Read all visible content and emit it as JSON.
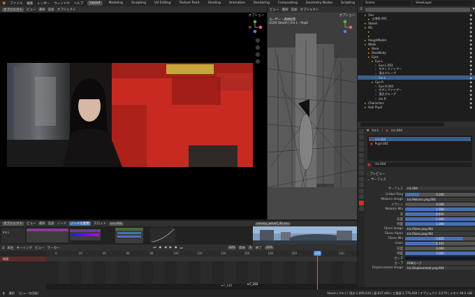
{
  "topbar": {
    "menus": [
      "ファイル",
      "編集",
      "レンダー",
      "ウィンドウ",
      "ヘルプ"
    ],
    "workspaces": [
      "Layout",
      "Modeling",
      "Sculpting",
      "UV Editing",
      "Texture Paint",
      "Shading",
      "Animation",
      "Rendering",
      "Compositing",
      "Geometry Nodes",
      "Scripting"
    ],
    "active_workspace": "Layout",
    "scene": "Scene",
    "view_layer": "ViewLayer"
  },
  "viewport_left": {
    "mode": "オブジェクト",
    "menus": [
      "ビュー",
      "選択",
      "追加",
      "オブジェクト"
    ],
    "options": "オプション"
  },
  "viewport_right": {
    "menus": [
      "ビュー",
      "選択",
      "追加",
      "オブジェクト"
    ],
    "options": "オプション",
    "camera_line1": "ユーザー・透視投影",
    "camera_line2": "(220) Steam | Iris L : Pupil"
  },
  "outliner": {
    "rows": [
      {
        "label": "Vial",
        "indent": 2,
        "selected": false
      },
      {
        "label": "土地柱.001",
        "indent": 3,
        "selected": false
      },
      {
        "label": "Steam",
        "indent": 2,
        "selected": false
      },
      {
        "label": "BG",
        "indent": 2,
        "selected": false
      },
      {
        "label": "",
        "indent": 3,
        "selected": false
      },
      {
        "label": "",
        "indent": 3,
        "selected": false
      },
      {
        "label": "RoughModel",
        "indent": 2,
        "selected": false
      },
      {
        "label": "Walls",
        "indent": 2,
        "selected": false
      },
      {
        "label": "Base",
        "indent": 3,
        "selected": false
      },
      {
        "label": "BaseBody",
        "indent": 3,
        "selected": false
      },
      {
        "label": "Eyes",
        "indent": 3,
        "selected": false
      },
      {
        "label": "Eye L",
        "indent": 4,
        "selected": false
      },
      {
        "label": "Eye L.002",
        "indent": 5,
        "selected": false
      },
      {
        "label": "モディファイアー",
        "indent": 5,
        "selected": false
      },
      {
        "label": "頂点グループ",
        "indent": 5,
        "selected": false
      },
      {
        "label": "Iris L",
        "indent": 5,
        "selected": true
      },
      {
        "label": "Eye R",
        "indent": 4,
        "selected": false
      },
      {
        "label": "Eye R.002",
        "indent": 5,
        "selected": false
      },
      {
        "label": "モディファイアー",
        "indent": 5,
        "selected": false
      },
      {
        "label": "頂点グループ",
        "indent": 5,
        "selected": false
      },
      {
        "label": "Iris R",
        "indent": 5,
        "selected": false
      },
      {
        "label": "Characters",
        "indent": 2,
        "selected": false
      },
      {
        "label": "Hair Pupil",
        "indent": 2,
        "selected": false
      }
    ]
  },
  "properties": {
    "object_name": "Iris L",
    "material_name": "iris.004",
    "slots": [
      {
        "label": "iris.004",
        "selected": true
      },
      {
        "label": "Pupil.001",
        "selected": false
      }
    ],
    "material_field": "iris.004",
    "preview_label": "プレビュー",
    "surface_section": "サーフェス",
    "surface_label": "サーフェス",
    "surface_value": "iris.004",
    "rows": [
      {
        "label": "Limbal Ring",
        "value": "0.200",
        "fill": 0.2
      },
      {
        "label": "Melanin Image",
        "value": "Iris Melanin.png.004",
        "fill": 0
      },
      {
        "label": "メラニン",
        "value": "0.000",
        "fill": 0
      },
      {
        "label": "Melanin Mix",
        "value": "1.000",
        "fill": 1
      },
      {
        "label": "赤",
        "value": "0.500",
        "fill": 0.5
      },
      {
        "label": "彩度",
        "value": "1.000",
        "fill": 1
      },
      {
        "label": "明度",
        "value": "1.000",
        "fill": 1
      },
      {
        "label": "Fibres Image",
        "value": "Iris Fibres.png.004",
        "fill": 0
      },
      {
        "label": "Fibres Alpha",
        "value": "Iris Fibres.png.004",
        "fill": 0
      },
      {
        "label": "Fibres Mix",
        "value": "0.825",
        "fill": 0.825
      },
      {
        "label": "Grain",
        "value": "0.462",
        "fill": 0.462
      },
      {
        "label": "彩度",
        "value": "0.000",
        "fill": 0
      },
      {
        "label": "明度",
        "value": "1.000",
        "fill": 1
      },
      {
        "label": "ガンマ",
        "value": "",
        "fill": 0
      },
      {
        "label": "カーブ",
        "value": "RGBカーブ",
        "fill": 0
      },
      {
        "label": "Displacement Image",
        "value": "Iris Displacement.png.004",
        "fill": 0
      }
    ]
  },
  "node_editor": {
    "mode": "オブジェクト",
    "menus": [
      "ビュー",
      "選択",
      "追加",
      "ノード"
    ],
    "use_nodes": "ノードを使用",
    "slot": "スロット",
    "material": "iris.004",
    "sidebar_label": "Iris L",
    "image_name": "canary_wharf_4k.exr"
  },
  "timeline": {
    "menus": [
      "再生",
      "キーイング",
      "ビュー",
      "マーカー"
    ],
    "current_frame": "220",
    "start_label": "開始",
    "start": "1",
    "end_label": "終了",
    "end": "220",
    "ticks": [
      "0",
      "20",
      "40",
      "60",
      "80",
      "100",
      "120",
      "140",
      "160",
      "180",
      "200",
      "220",
      "240"
    ],
    "markers": [
      "F_140",
      "F_162"
    ],
    "track_label": "概要"
  },
  "statusbar": {
    "left": "選択",
    "mid": "(ビューを回転)",
    "right": "Steam | Iris L | 頂点:1,009,630 | 面:837,464 | 三角面:1,776,930 | オブジェクト:1/179 | メモリ:38.0 GiB"
  },
  "colors": {
    "accent": "#4772b3",
    "select": "#3a5e8f",
    "playhead": "#4a90e2",
    "red_wall": "#c82a22"
  }
}
